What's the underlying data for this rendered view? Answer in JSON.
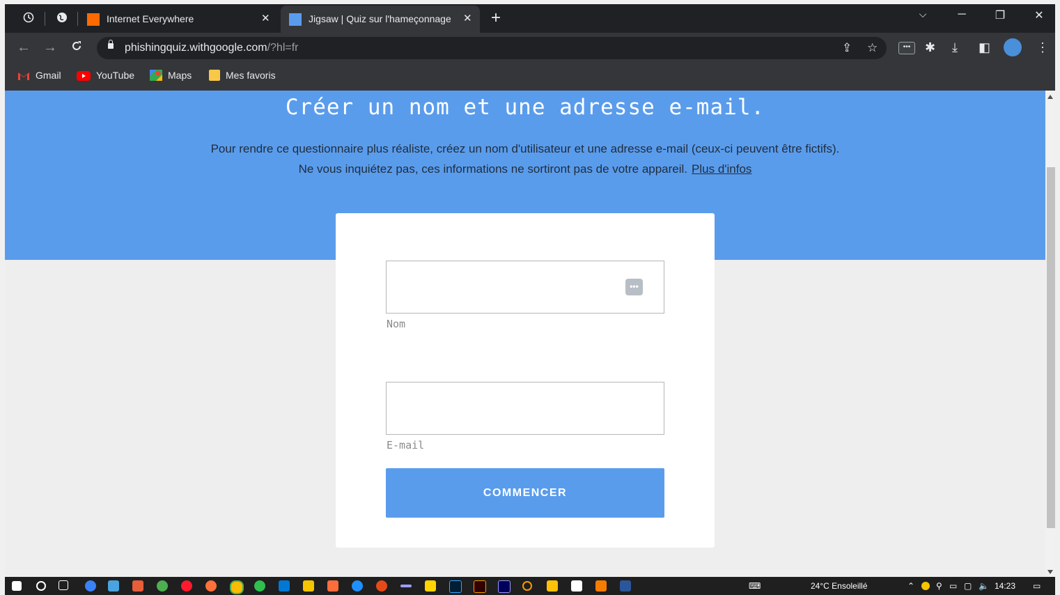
{
  "tabs": [
    {
      "title": "Internet Everywhere",
      "active": false,
      "favicon_color": "#ff6a00"
    },
    {
      "title": "Jigsaw | Quiz sur l'hameçonnage",
      "active": true,
      "favicon_color": "#5a9cec"
    }
  ],
  "omnibox": {
    "host": "phishingquiz.withgoogle.com",
    "path": "/?hl=fr"
  },
  "bookmarks": [
    {
      "label": "Gmail",
      "icon": "gmail-icon"
    },
    {
      "label": "YouTube",
      "icon": "youtube-icon"
    },
    {
      "label": "Maps",
      "icon": "maps-icon"
    },
    {
      "label": "Mes favoris",
      "icon": "folder-icon"
    }
  ],
  "hero": {
    "title": "Créer un nom et une adresse e-mail.",
    "desc_line1": "Pour rendre ce questionnaire plus réaliste, créez un nom d'utilisateur et une adresse e-mail (ceux-ci peuvent être fictifs).",
    "desc_line2": "Ne vous inquiétez pas, ces informations ne sortiront pas de votre appareil.",
    "more_link": "Plus d'infos"
  },
  "form": {
    "name_label": "Nom",
    "email_label": "E-mail",
    "name_value": "",
    "email_value": "",
    "submit_label": "COMMENCER"
  },
  "taskbar": {
    "weather": "24°C  Ensoleillé",
    "time": "14:23"
  },
  "colors": {
    "accent": "#5a9cec",
    "page_bg": "#eeeeee",
    "chrome_dark": "#202124",
    "chrome_toolbar": "#35363a"
  }
}
